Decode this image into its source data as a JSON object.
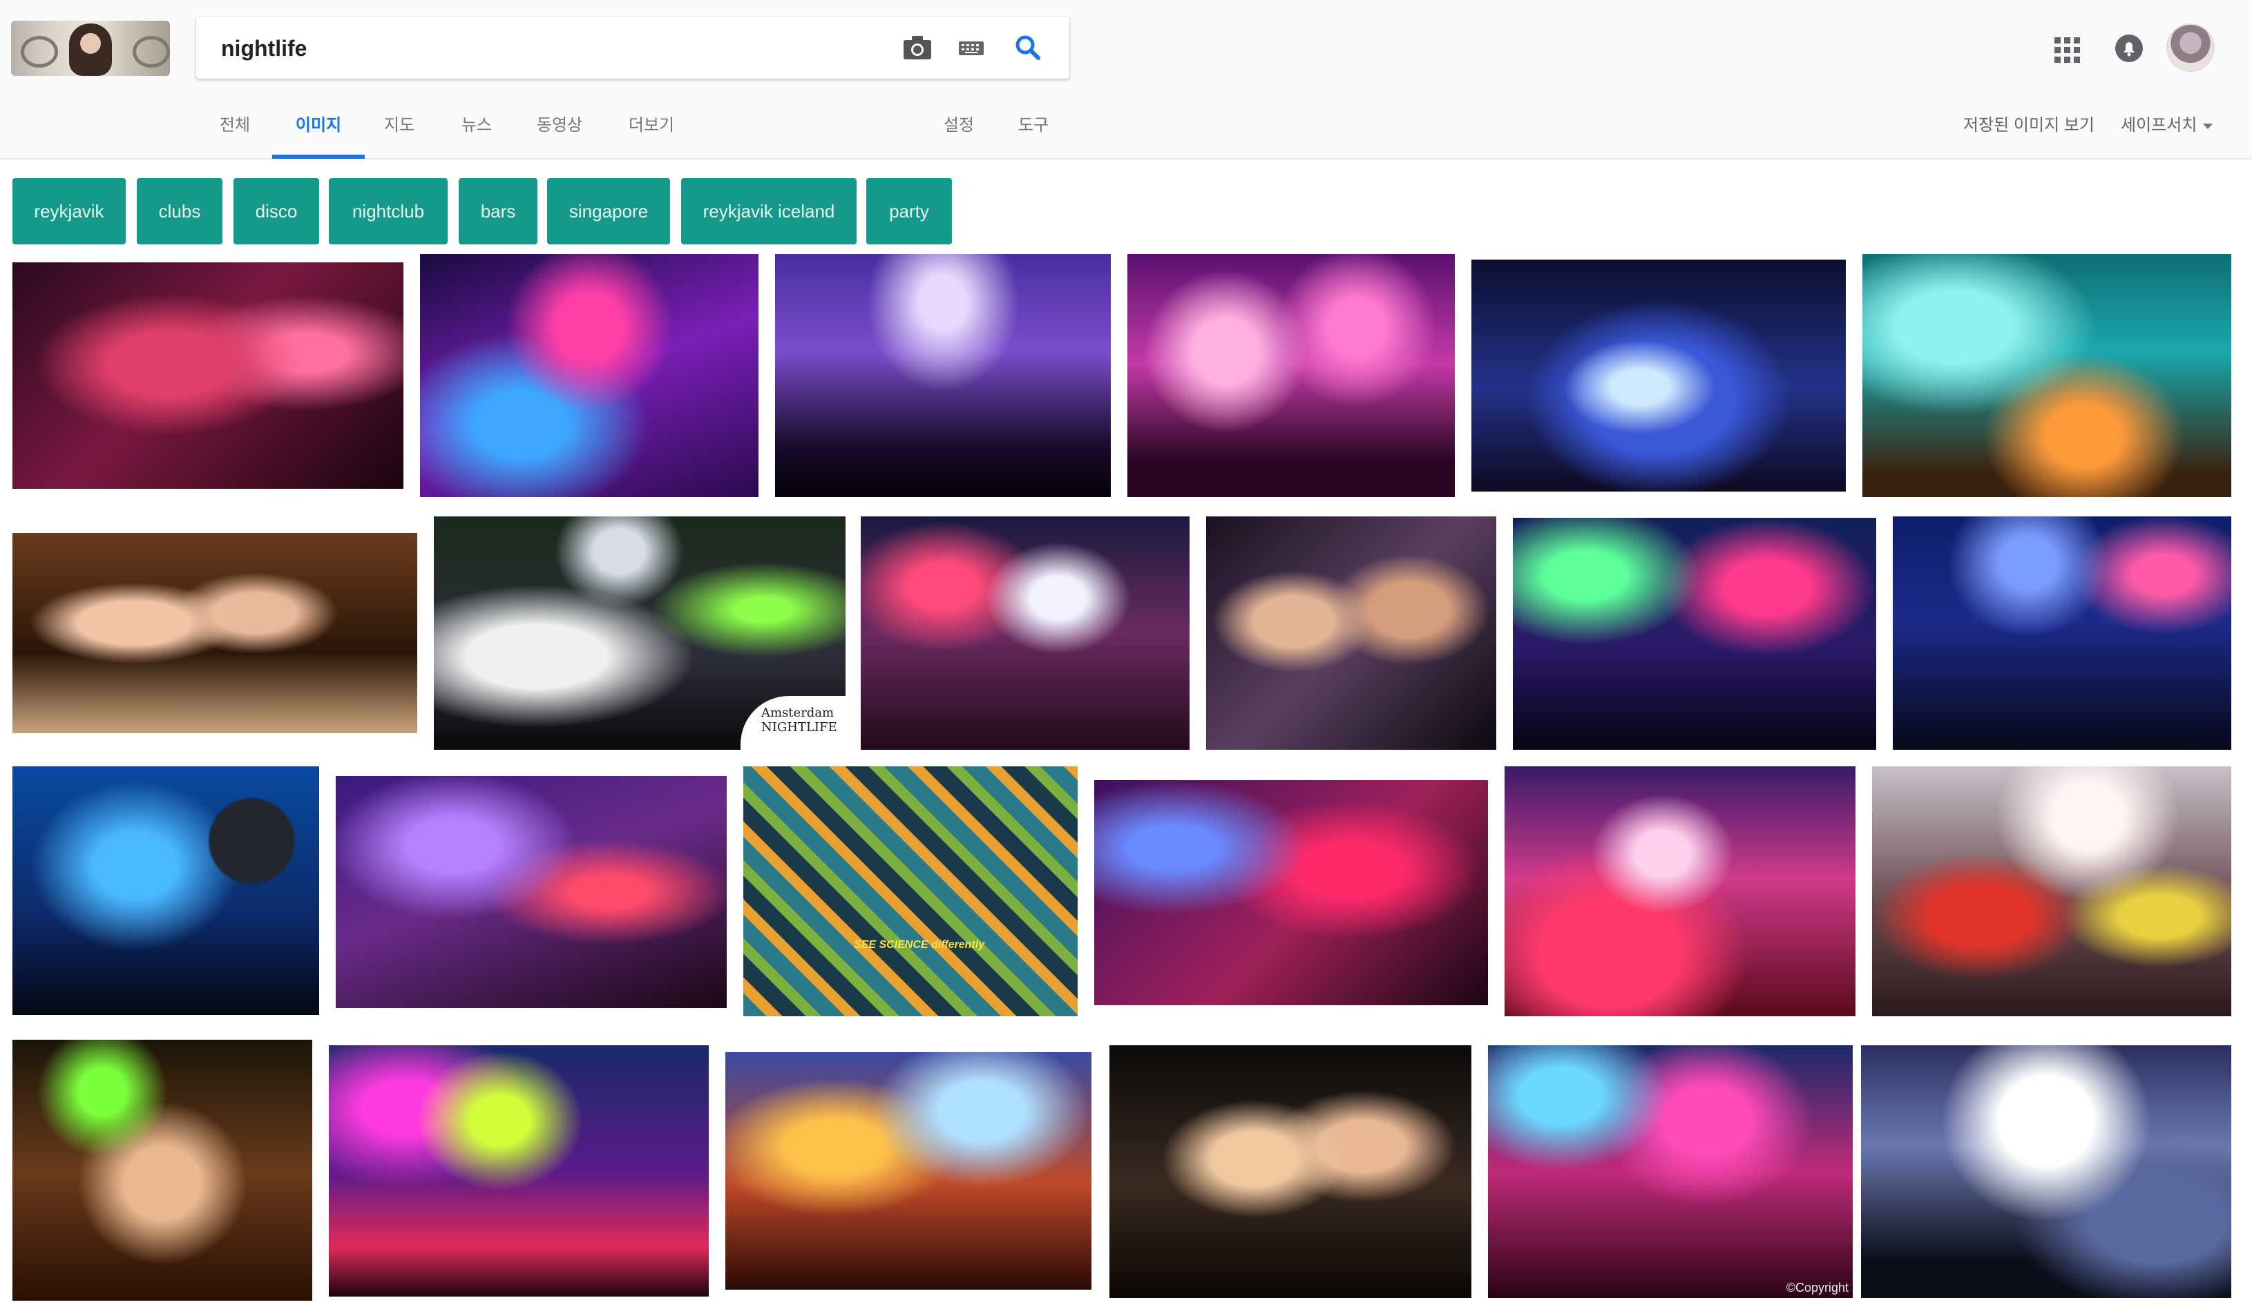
{
  "search": {
    "query": "nightlife"
  },
  "tabs": [
    {
      "label": "전체"
    },
    {
      "label": "이미지"
    },
    {
      "label": "지도"
    },
    {
      "label": "뉴스"
    },
    {
      "label": "동영상"
    },
    {
      "label": "더보기"
    },
    {
      "label": "설정"
    },
    {
      "label": "도구"
    }
  ],
  "active_tab": "이미지",
  "right_links": {
    "saved_images": "저장된 이미지 보기",
    "safesearch": "세이프서치"
  },
  "related_chips": [
    "reykjavik",
    "clubs",
    "disco",
    "nightclub",
    "bars",
    "singapore",
    "reykjavik iceland",
    "party"
  ],
  "colors": {
    "accent": "#1a73e8",
    "chip_bg": "#15998a"
  },
  "icons": [
    "camera-icon",
    "keyboard-icon",
    "search-icon",
    "apps-grid-icon",
    "notifications-icon",
    "caret-down-icon"
  ],
  "results": [
    "crowd-club-people",
    "friends-cheers-drinks",
    "concert-crowd-hands",
    "confetti-crowd",
    "aerial-pool-party",
    "teal-festival-crowd",
    "friends-selfie",
    "amsterdam-nightlife-laser",
    "festival-stage-lights",
    "women-dancing-party",
    "neon-club-crowd",
    "blue-club-crowd",
    "blue-disco-ball-crowd",
    "purple-concert-silhouettes",
    "science-illustration",
    "neon-dancers",
    "red-club-crowd",
    "party-dancing-couples",
    "green-laser-crowd",
    "disco-ball-laser-club",
    "confetti-smoke-crowd",
    "friends-singing-club",
    "pink-club-dancer",
    "dj-booth-smoke"
  ],
  "result_texts": {
    "amsterdam_logo": "Amsterdam NIGHTLIFE",
    "science_caption": "SEE SCIENCE differently",
    "copyright": "©Copyright"
  }
}
